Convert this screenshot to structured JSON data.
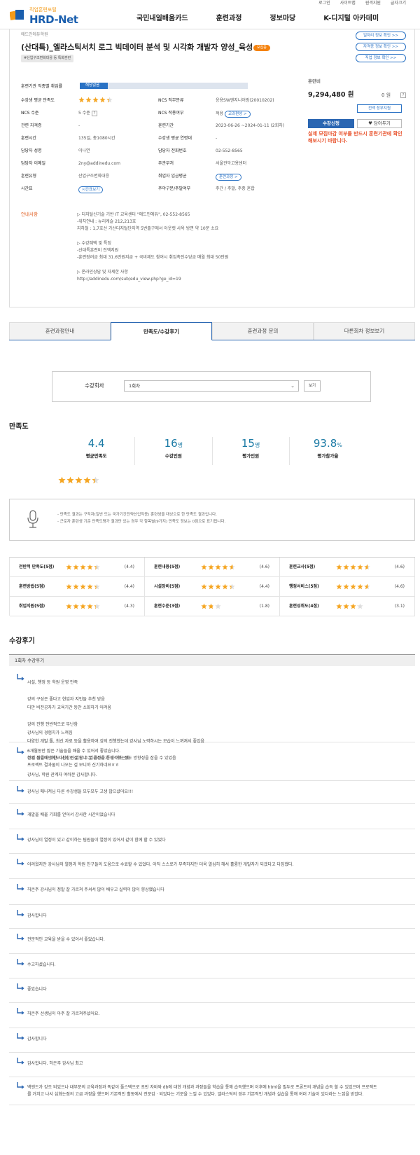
{
  "header": {
    "logo_small": "직업훈련포털",
    "logo_main": "HRD-Net",
    "top_links": [
      "로그인",
      "사이트맵",
      "원격지원",
      "글자크기"
    ],
    "nav": [
      "국민내일배움카드",
      "훈련과정",
      "정보마당",
      "K-디지털 아카데미"
    ]
  },
  "course": {
    "org": "애드인에듀학원",
    "title": "(산대특)_엘라스틱서치 로그 빅데이터 분석 및 시각화 개발자 양성_육성",
    "tag_new": "모집중",
    "tag_category": "#산업구조변화대응 등 특화훈련",
    "side_links": [
      "일자리 정보 확인 >>",
      "자격증 정보 확인 >>",
      "직업 정보 확인 >>"
    ]
  },
  "info": {
    "employment_label": "훈련기관 직종별 취업률",
    "employment_value": "해당없음",
    "rows": [
      {
        "l1": "수강생 평균 만족도",
        "v1": "",
        "l2": "NCS 직무분류",
        "v2": "응용SW엔지니어링(20010202)"
      },
      {
        "l1": "NCS 수준",
        "v1": "5 수준",
        "l2": "NCS 적용여부",
        "v2": "적용"
      },
      {
        "l1": "관련 자격증",
        "v1": "-",
        "l2": "훈련기간",
        "v2": "2023-06-26 ~2024-01-11 (2회차)"
      },
      {
        "l1": "훈련시간",
        "v1": "135일, 총1080시간",
        "l2": "수강생 평균 연령대",
        "v2": "-"
      },
      {
        "l1": "담당자 성명",
        "v1": "이나연",
        "l2": "담당자 전화번호",
        "v2": "02-552-8565"
      },
      {
        "l1": "담당자 이메일",
        "v1": "2ny@addinedu.com",
        "l2": "주관부처",
        "v2": "서울관악고용센터"
      },
      {
        "l1": "훈련유형",
        "v1": "산업구조변화대응",
        "l2": "취업자 임금평균",
        "v2": ""
      },
      {
        "l1": "시간표",
        "v1": "",
        "l2": "주야구분/주말여부",
        "v2": "주간 / 주말, 주중 혼합"
      }
    ],
    "pill_curriculum": "교과편성 >",
    "pill_training": "훈련과정 >",
    "pill_timetable": "시간표보기",
    "avg_rating": 4.4
  },
  "fee": {
    "label": "훈련비",
    "amount": "9,294,480 원",
    "self_pay": "0 원",
    "full_support": "전액 정부지원",
    "apply": "수강신청",
    "wish": "담아두기",
    "note": "실제 모집마감 여부를 반드시 훈련기관에 확인해보시기 바랍니다."
  },
  "notice": {
    "label": "안내사항",
    "text": "▷ 디지털신기술 기반 IT 교육센터 \"애드인에듀\", 02-552-8565\n-위치안내 : 뉴리케슬 212,213호\n지하철 : 1,7호선 가산디지털단지역 5번출구에서 아웃렛 사옥 방면 약 10분 소요\n\n▷ 수강혜택 및 특징\n-산대특훈련비 전액지원\n-훈련장려금 최대 31.6만원지급 + 국비제도 참여시 취업촉진수당금 매월 최대 50만원\n\n▷ 온라인상담 및 자세한 사항\nhttp://addinedu.com/sub/edu_view.php?ge_id=19"
  },
  "tabs": [
    "훈련과정안내",
    "만족도/수강후기",
    "훈련과정 문의",
    "다른회차 정보보기"
  ],
  "session": {
    "label": "수강회차",
    "value": "1회차",
    "button": "보기"
  },
  "satisfaction": {
    "heading": "만족도",
    "metrics": [
      {
        "num": "4.4",
        "unit": "",
        "label": "평균만족도"
      },
      {
        "num": "16",
        "unit": "명",
        "label": "수강인원"
      },
      {
        "num": "15",
        "unit": "명",
        "label": "평가인원"
      },
      {
        "num": "93.8",
        "unit": "%",
        "label": "평가참가율"
      }
    ],
    "notes": "- 만족도 결과는 구직자(일반 또는 국가기간전략산업직종) 훈련생을 대상으로 한 만족도 결과입니다.\n- 근로자 훈련생 기준 만족도평가 결과만 있는 경우 각 항목별(9가지) 만족도 정보는 0점으로 표기됩니다.",
    "scores": [
      [
        {
          "label": "전반적 만족도(5점)",
          "value": "(4.4)",
          "rating": 4.4
        },
        {
          "label": "훈련내용(5점)",
          "value": "(4.6)",
          "rating": 4.6
        },
        {
          "label": "훈련교사(5점)",
          "value": "(4.6)",
          "rating": 4.6
        }
      ],
      [
        {
          "label": "훈련방법(5점)",
          "value": "(4.4)",
          "rating": 4.4
        },
        {
          "label": "시설장비(5점)",
          "value": "(4.4)",
          "rating": 4.4
        },
        {
          "label": "행정서비스(5점)",
          "value": "(4.6)",
          "rating": 4.6
        }
      ],
      [
        {
          "label": "취업지원(5점)",
          "value": "(4.3)",
          "rating": 4.3
        },
        {
          "label": "훈련수준(3점)",
          "value": "(1.8)",
          "rating": 1.8
        },
        {
          "label": "훈련성취도(4점)",
          "value": "(3.1)",
          "rating": 3.1
        }
      ]
    ]
  },
  "reviews": {
    "heading": "수강후기",
    "session_label": "1회차 수강후기",
    "items": [
      "시설, 행정 등 학원 운영 만족\n\n강의 구성은 좋다고 현업자 지인들 추천 받음\n다만 비전공자가 교육기간 동안 소화하기 어려움\n\n강의 진행 전반적으로 무난함\n강사님의 경험치가 느껴짐\n다양한 개발 툴, 최신 자료 등을 활용하여 강의 진행했는데 강사님 노력하시는 모습이 느껴져서 좋았음\n\n현재 취업에 대한 자신감은 없으나 본 과정을 통해 어느 정도 방향성을 잡을 수 있었음\n\n강사님, 학원 관계자 여러분 감사합니다.",
      "6개월동안 많은 기술들을 배울 수 있어서 좋았습니다.\n수업 들을때만해도 내가 이걸 할 수 있을까라고 생각했는데,\n프로젝트 결과물이 나오는 걸 보니까 신기하네요ㅎㅎ",
      "강사님 매니저님 다른 수강생들 모두모두 고생 많으셨어요!!!",
      "개발을 배울 기회를 얻어서 감사한 시간이었습니다",
      "강사님이 열정이 있고 같이하는 팀원들이 열정이 있어서 같이 함께 할 수 있었다",
      "어려웠지만 강사님의 열정과 학원 친구들의 도움으로 수료할 수 있었다. 아직 스스로가 부족하지만 더욱 열심히 해서 훌륭한 개발자가 되겠다고 다짐했다.",
      "허은주 강사님이 정말 잘 가르쳐 주셔서 많이 배우고 실력이 많이 향상했습니다",
      "감사합니다",
      "전문적인 교육을 받을 수 있어서 좋았습니다.",
      "수고하셨습니다.",
      "좋았습니다",
      "허은주 선생님이 아주 잘 가르쳐주셨어요.",
      "감사합니다",
      "감사합니다. 허은주 강사님 최고",
      "백엔드가 강조 되었으나 대부분의 교육과정과 똑같이 풀스택으로 초반 자바와 db에 대한 개념과 과정들을 학습을 통해 습득했으며 이후에 html을 필두로 프론트의 개념을 습득 할 수 있었으며 프로젝트\n를 거치고 나서 심화는점의 고급 과정을 했으며 기본적인 활동에서 전문감 · 되었다는 기분을 느낄 수 있었다. 엘라스틱의 경우 기본적인 개념과 실습을 통해 여러 기술이 있다라는 느낌을 받았다."
    ]
  }
}
